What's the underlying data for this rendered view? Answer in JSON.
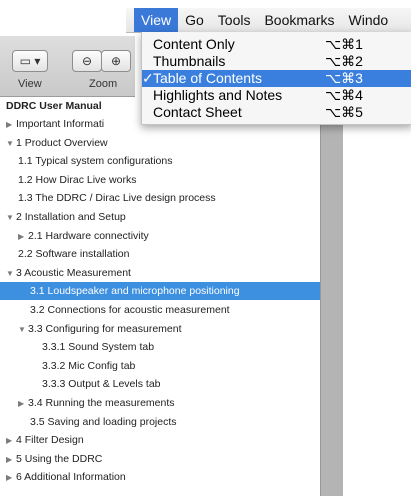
{
  "menubar": {
    "items": [
      "View",
      "Go",
      "Tools",
      "Bookmarks",
      "Windo"
    ],
    "active_index": 0
  },
  "view_menu": {
    "items": [
      {
        "label": "Content Only",
        "shortcut": "⌥⌘1",
        "checked": false
      },
      {
        "label": "Thumbnails",
        "shortcut": "⌥⌘2",
        "checked": false
      },
      {
        "label": "Table of Contents",
        "shortcut": "⌥⌘3",
        "checked": true
      },
      {
        "label": "Highlights and Notes",
        "shortcut": "⌥⌘4",
        "checked": false
      },
      {
        "label": "Contact Sheet",
        "shortcut": "⌥⌘5",
        "checked": false
      }
    ],
    "check_glyph": "✓"
  },
  "toolbar": {
    "view_label": "View",
    "zoom_label": "Zoom",
    "view_icon": "sidebar-toggle-icon",
    "zoom_out_icon": "zoom-out-icon",
    "zoom_in_icon": "zoom-in-icon"
  },
  "toc": {
    "title": "DDRC User Manual",
    "items": [
      {
        "label": "Important Informati",
        "triangle": "▶"
      },
      {
        "label": "1 Product Overview",
        "triangle": "▼"
      },
      {
        "label": "1.1 Typical system configurations",
        "triangle": ""
      },
      {
        "label": "1.2 How Dirac Live works",
        "triangle": ""
      },
      {
        "label": "1.3 The DDRC / Dirac Live design process",
        "triangle": ""
      },
      {
        "label": "2 Installation and Setup",
        "triangle": "▼"
      },
      {
        "label": "2.1 Hardware connectivity",
        "triangle": "▶"
      },
      {
        "label": "2.2 Software installation",
        "triangle": ""
      },
      {
        "label": "3 Acoustic Measurement",
        "triangle": "▼"
      },
      {
        "label": "3.1 Loudspeaker and microphone positioning",
        "triangle": ""
      },
      {
        "label": "3.2 Connections for acoustic measurement",
        "triangle": ""
      },
      {
        "label": "3.3 Configuring for measurement",
        "triangle": "▼"
      },
      {
        "label": "3.3.1 Sound System tab",
        "triangle": ""
      },
      {
        "label": "3.3.2 Mic Config tab",
        "triangle": ""
      },
      {
        "label": "3.3.3 Output & Levels tab",
        "triangle": ""
      },
      {
        "label": "3.4 Running the measurements",
        "triangle": "▶"
      },
      {
        "label": "3.5 Saving and loading projects",
        "triangle": ""
      },
      {
        "label": "4 Filter Design",
        "triangle": "▶"
      },
      {
        "label": "5 Using the DDRC",
        "triangle": "▶"
      },
      {
        "label": "6 Additional Information",
        "triangle": "▶"
      }
    ],
    "selected_index": 9
  },
  "colors": {
    "menu_highlight": "#3a79d8",
    "toc_selection": "#3d8fe0"
  }
}
